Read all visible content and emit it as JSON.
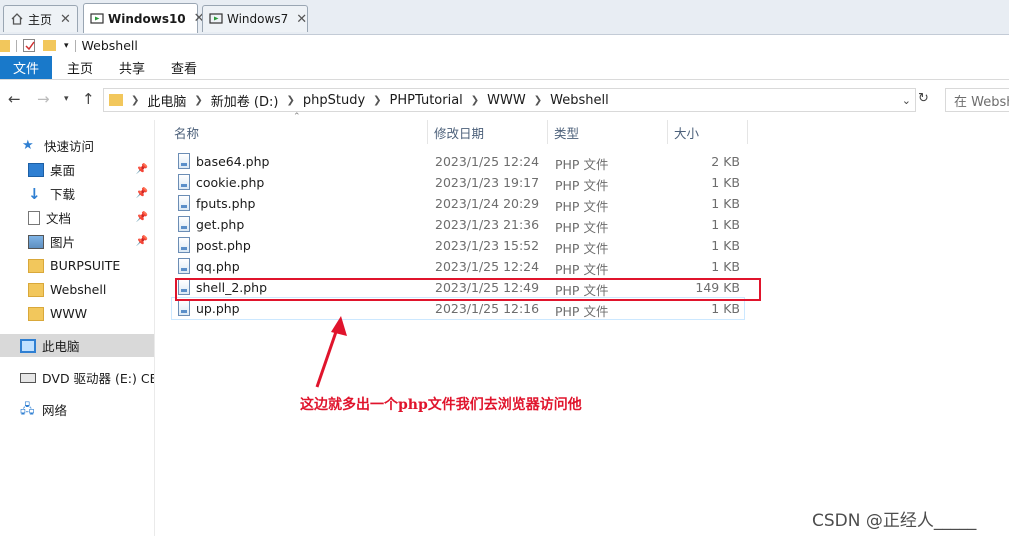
{
  "vm_tabs": [
    {
      "label": "主页"
    },
    {
      "label": "Windows10"
    },
    {
      "label": "Windows7"
    }
  ],
  "quick_access_title": "Webshell",
  "ribbon": {
    "file_tab": "文件",
    "tabs": [
      "主页",
      "共享",
      "查看"
    ]
  },
  "address": {
    "crumbs": [
      "此电脑",
      "新加卷 (D:)",
      "phpStudy",
      "PHPTutorial",
      "WWW",
      "Webshell"
    ],
    "search_placeholder": "在 Websh"
  },
  "sidebar": {
    "items": [
      {
        "label": "快速访问",
        "icon": "star-icon"
      },
      {
        "label": "桌面",
        "icon": "desktop-icon",
        "pinned": true
      },
      {
        "label": "下载",
        "icon": "download-icon",
        "pinned": true
      },
      {
        "label": "文档",
        "icon": "document-icon",
        "pinned": true
      },
      {
        "label": "图片",
        "icon": "picture-icon",
        "pinned": true
      },
      {
        "label": "BURPSUITE",
        "icon": "folder-icon"
      },
      {
        "label": "Webshell",
        "icon": "folder-icon"
      },
      {
        "label": "WWW",
        "icon": "folder-icon"
      },
      {
        "label": "此电脑",
        "icon": "computer-icon",
        "selected": true
      },
      {
        "label": "DVD 驱动器 (E:) CES",
        "icon": "dvd-icon"
      },
      {
        "label": "网络",
        "icon": "network-icon"
      }
    ]
  },
  "columns": {
    "name": "名称",
    "date": "修改日期",
    "type": "类型",
    "size": "大小"
  },
  "files": [
    {
      "name": "base64.php",
      "date": "2023/1/25 12:24",
      "type": "PHP 文件",
      "size": "2 KB"
    },
    {
      "name": "cookie.php",
      "date": "2023/1/23 19:17",
      "type": "PHP 文件",
      "size": "1 KB"
    },
    {
      "name": "fputs.php",
      "date": "2023/1/24 20:29",
      "type": "PHP 文件",
      "size": "1 KB"
    },
    {
      "name": "get.php",
      "date": "2023/1/23 21:36",
      "type": "PHP 文件",
      "size": "1 KB"
    },
    {
      "name": "post.php",
      "date": "2023/1/23 15:52",
      "type": "PHP 文件",
      "size": "1 KB"
    },
    {
      "name": "qq.php",
      "date": "2023/1/25 12:24",
      "type": "PHP 文件",
      "size": "1 KB"
    },
    {
      "name": "shell_2.php",
      "date": "2023/1/25 12:49",
      "type": "PHP 文件",
      "size": "149 KB"
    },
    {
      "name": "up.php",
      "date": "2023/1/25 12:16",
      "type": "PHP 文件",
      "size": "1 KB"
    }
  ],
  "annotation": "这边就多出一个php文件我们去浏览器访问他",
  "watermark": "CSDN @正经人_____",
  "colors": {
    "accent": "#1979ca",
    "annotation_red": "#e0142c"
  }
}
